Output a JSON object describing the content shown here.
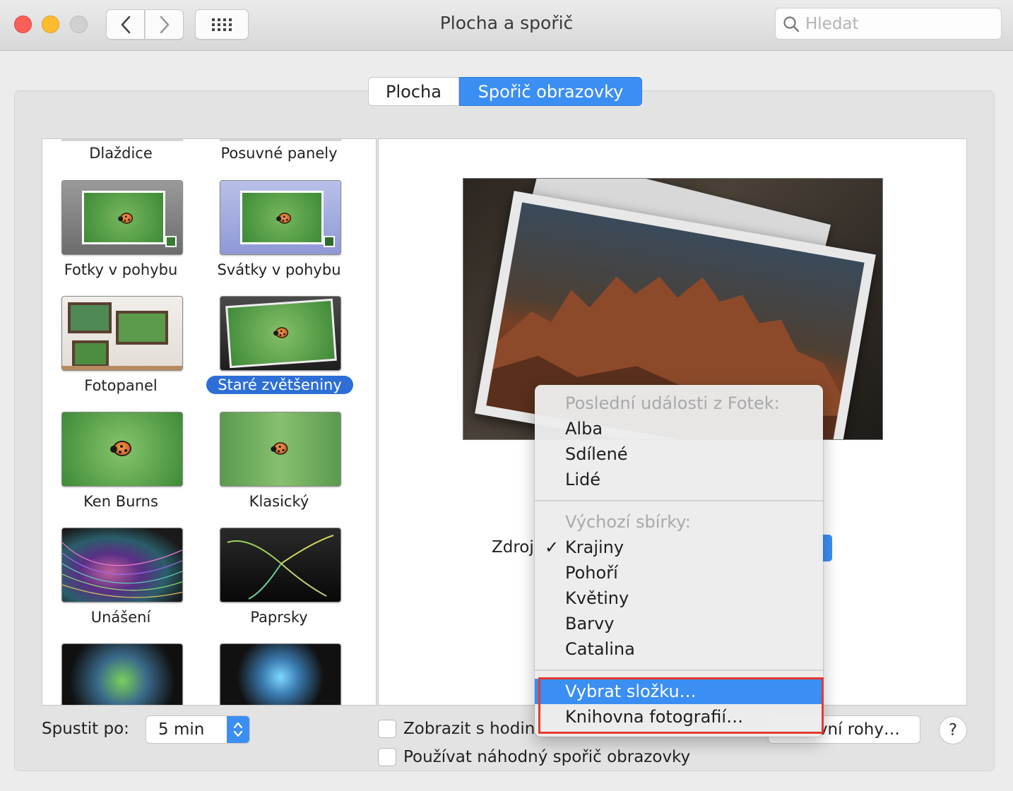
{
  "window": {
    "title": "Plocha a spořič",
    "search_placeholder": "Hledat"
  },
  "tabs": [
    {
      "label": "Plocha",
      "active": false
    },
    {
      "label": "Spořič obrazovky",
      "active": true
    }
  ],
  "savers": [
    {
      "label": "Dlaždice"
    },
    {
      "label": "Posuvné panely"
    },
    {
      "label": "Fotky v pohybu"
    },
    {
      "label": "Svátky v pohybu"
    },
    {
      "label": "Fotopanel"
    },
    {
      "label": "Staré zvětšeniny",
      "selected": true
    },
    {
      "label": "Ken Burns"
    },
    {
      "label": "Klasický"
    },
    {
      "label": "Unášení"
    },
    {
      "label": "Paprsky"
    }
  ],
  "source": {
    "label": "Zdroj"
  },
  "menu": {
    "header_recent": "Poslední události z Fotek:",
    "recent_items": [
      "Alba",
      "Sdílené",
      "Lidé"
    ],
    "header_default": "Výchozí sbírky:",
    "default_items": [
      "Krajiny",
      "Pohoří",
      "Květiny",
      "Barvy",
      "Catalina"
    ],
    "checked_item": "Krajiny",
    "check_mark": "✓",
    "action_items": [
      "Vybrat složku…",
      "Knihovna fotografií…"
    ],
    "highlighted_item": "Vybrat složku…"
  },
  "bottom": {
    "start_label": "Spustit po:",
    "start_value": "5 min",
    "show_clock_label": "Zobrazit s hodin",
    "random_label": "Používat náhodný spořič obrazovky",
    "corners_label": "vní rohy…",
    "help_label": "?"
  },
  "colors": {
    "accent": "#3b8ef2",
    "selection": "#2d6fd7",
    "highlight_box": "#e53a2f"
  }
}
